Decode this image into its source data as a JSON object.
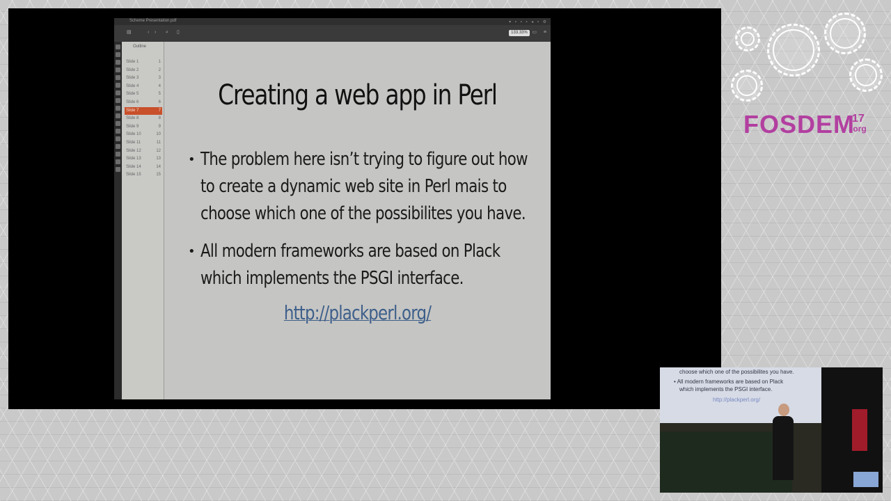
{
  "viewer": {
    "window_title": "Scheme Presentation.pdf",
    "zoom": "133.33%",
    "sidebar_title": "Outline",
    "slides": [
      {
        "label": "Slide 1",
        "page": "1"
      },
      {
        "label": "Slide 2",
        "page": "2"
      },
      {
        "label": "Slide 3",
        "page": "3"
      },
      {
        "label": "Slide 4",
        "page": "4"
      },
      {
        "label": "Slide 5",
        "page": "5"
      },
      {
        "label": "Slide 6",
        "page": "6"
      },
      {
        "label": "Slide 7",
        "page": "7"
      },
      {
        "label": "Slide 8",
        "page": "8"
      },
      {
        "label": "Slide 9",
        "page": "9"
      },
      {
        "label": "Slide 10",
        "page": "10"
      },
      {
        "label": "Slide 11",
        "page": "11"
      },
      {
        "label": "Slide 12",
        "page": "12"
      },
      {
        "label": "Slide 13",
        "page": "13"
      },
      {
        "label": "Slide 14",
        "page": "14"
      },
      {
        "label": "Slide 15",
        "page": "15"
      }
    ],
    "active_slide": "Slide 7"
  },
  "slide": {
    "title": "Creating a web app in Perl",
    "bullet1_lines": [
      "The problem here isn’t trying to figure out how",
      "to create a dynamic web site in Perl mais to",
      "choose which one of the possibilites you have."
    ],
    "bullet2_lines": [
      "All modern frameworks are based on Plack",
      "which implements the PSGI interface."
    ],
    "link": "http://plackperl.org/"
  },
  "branding": {
    "name": "FOSDEM",
    "year": "17",
    "tld": ".org",
    "color": "#b23fa0"
  },
  "pip": {
    "line1": "choose which one of the possibilites you have.",
    "line2": "• All modern frameworks are based on Plack",
    "line3": "which implements the PSGI interface.",
    "link": "http://plackperl.org/"
  }
}
